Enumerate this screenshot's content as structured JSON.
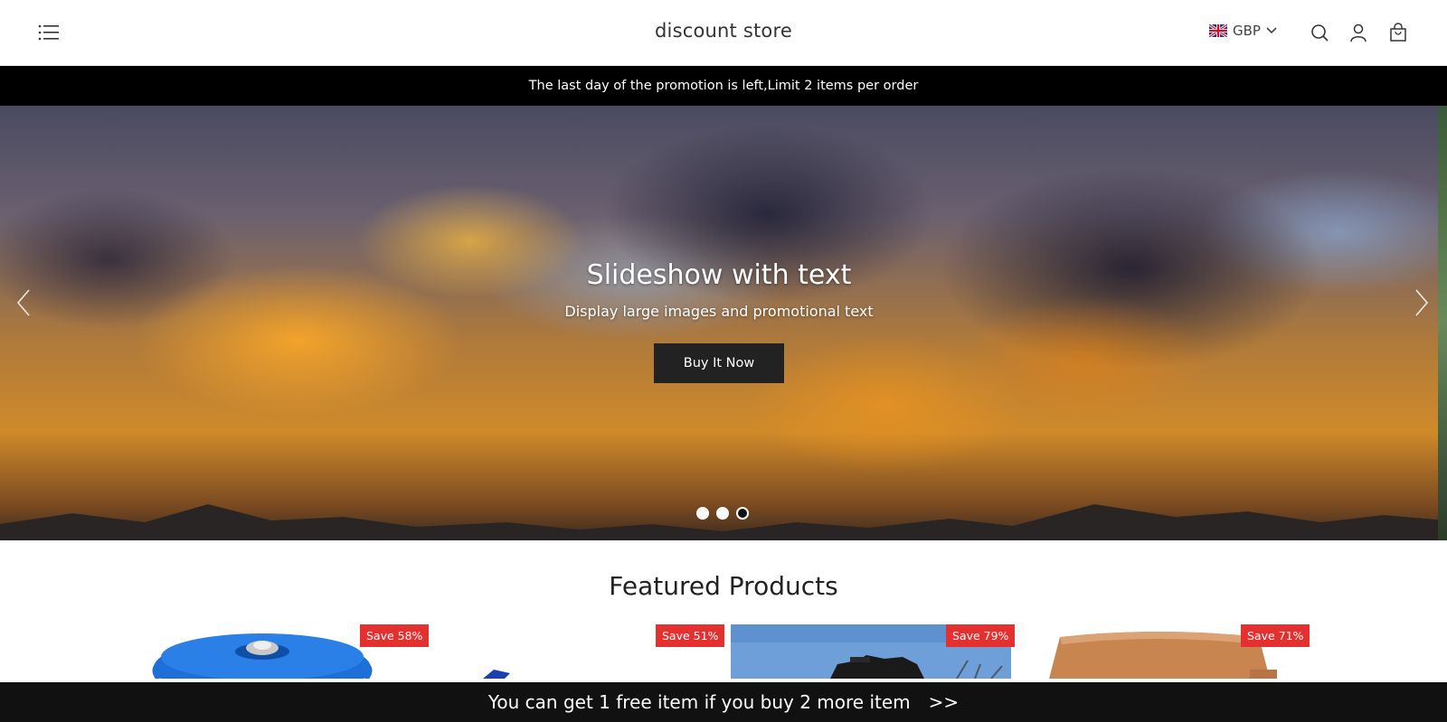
{
  "header": {
    "store_title": "discount store",
    "currency": "GBP",
    "icons": [
      "menu-icon",
      "flag-gb-icon",
      "chevron-down-icon",
      "search-icon",
      "account-icon",
      "cart-icon"
    ]
  },
  "announcement": {
    "text": "The last day of the promotion is left,Limit 2 items per order"
  },
  "slideshow": {
    "title": "Slideshow with text",
    "subtitle": "Display large images and promotional text",
    "button_label": "Buy It Now",
    "slide_count": 3,
    "active_slide": 3
  },
  "featured": {
    "title": "Featured Products",
    "products": [
      {
        "badge": "Save 58%",
        "image": "blue-cast-iron-pot"
      },
      {
        "badge": "Save 51%",
        "image": "blue-product"
      },
      {
        "badge": "Save 79%",
        "image": "motorcycle-sky"
      },
      {
        "badge": "Save 71%",
        "image": "wooden-tray"
      }
    ]
  },
  "bottom_bar": {
    "text": "You can get 1 free item if you buy 2 more item",
    "arrow": ">>"
  },
  "colors": {
    "announcement_bg": "#000000",
    "badge_bg": "#e53030",
    "button_bg": "#222222",
    "bottom_bar_bg": "#111111"
  }
}
